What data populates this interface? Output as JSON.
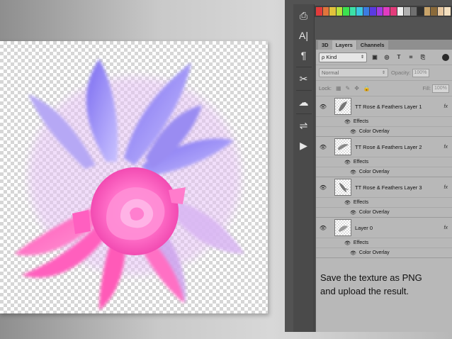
{
  "swatches": [
    "#e23b3b",
    "#e2743b",
    "#e2c23b",
    "#b7e23b",
    "#3be24f",
    "#3be2a7",
    "#3bc8e2",
    "#3b7ce2",
    "#5a3be2",
    "#a23be2",
    "#e23bc1",
    "#e23b7a",
    "#f0f0f0",
    "#b0b0b0",
    "#707070",
    "#303030",
    "#c9a46a",
    "#8a6a3a",
    "#e8c8a0",
    "#f4e0c0"
  ],
  "tools": [
    {
      "name": "stamp-tool-icon",
      "glyph": "⎙"
    },
    {
      "name": "type-tool-icon",
      "glyph": "A|"
    },
    {
      "name": "paragraph-tool-icon",
      "glyph": "¶"
    },
    {
      "name": "tools-crossed-icon",
      "glyph": "✂"
    },
    {
      "name": "creative-cloud-icon",
      "glyph": "☁"
    },
    {
      "name": "properties-icon",
      "glyph": "⇌"
    },
    {
      "name": "play-action-icon",
      "glyph": "▶"
    }
  ],
  "tabs": {
    "tab_3d": "3D",
    "tab_layers": "Layers",
    "tab_channels": "Channels"
  },
  "filter": {
    "kind_label": "ρ Kind",
    "arrow": "⇕",
    "icons": [
      "▣",
      "◎",
      "T",
      "⌗",
      "⎘"
    ]
  },
  "blend": {
    "mode": "Normal",
    "arrow": "⇕",
    "opacity_label": "Opacity:",
    "opacity_value": "100%"
  },
  "lock": {
    "label": "Lock:",
    "icons": [
      "▦",
      "✎",
      "✥",
      "🔒"
    ],
    "fill_label": "Fill:",
    "fill_value": "100%"
  },
  "layers": [
    {
      "name": "TT Rose & Feathers Layer 1",
      "effects": "Effects",
      "effect": "Color Overlay"
    },
    {
      "name": "TT Rose & Feathers Layer 2",
      "effects": "Effects",
      "effect": "Color Overlay"
    },
    {
      "name": "TT Rose & Feathers Layer 3",
      "effects": "Effects",
      "effect": "Color Overlay"
    },
    {
      "name": "Layer 0",
      "effects": "Effects",
      "effect": "Color Overlay"
    }
  ],
  "icons": {
    "eye": "👁",
    "fx": "fx"
  },
  "caption": {
    "line1": "Save the texture as PNG",
    "line2": "and upload the result."
  }
}
